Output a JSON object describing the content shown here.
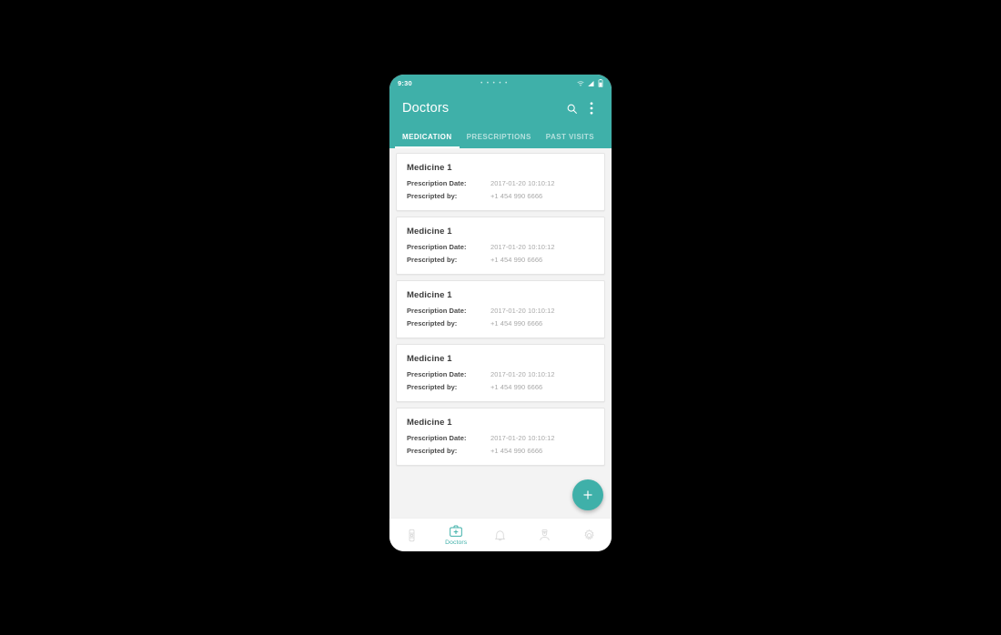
{
  "colors": {
    "accent": "#3fb0a9",
    "appbar_bg": "#3fb0a9",
    "content_bg": "#f3f3f3",
    "card_bg": "#ffffff",
    "title_text": "#3c3c3c",
    "label_text": "#4a4a4a",
    "value_text": "#a8a8a8",
    "tab_inactive": "rgba(255,255,255,0.62)",
    "fab_bg": "#3fb0a9"
  },
  "statusbar": {
    "time": "9:30",
    "center_dots": "• • • • •",
    "icons": [
      "wifi-icon",
      "signal-icon",
      "battery-icon"
    ]
  },
  "appbar": {
    "title": "Doctors",
    "actions": [
      {
        "name": "search-icon",
        "label": "Search"
      },
      {
        "name": "overflow-menu-icon",
        "label": "More options"
      }
    ]
  },
  "tabs": [
    {
      "label": "MEDICATION",
      "active": true
    },
    {
      "label": "PRESCRIPTIONS",
      "active": false
    },
    {
      "label": "PAST VISITS",
      "active": false
    }
  ],
  "list": {
    "labels": {
      "prescription_date": "Prescription Date:",
      "prescripted_by": "Prescripted by:"
    },
    "items": [
      {
        "title": "Medicine 1",
        "prescription_date": "2017-01-20 10:10:12",
        "prescripted_by": "+1 454 990 6666"
      },
      {
        "title": "Medicine 1",
        "prescription_date": "2017-01-20 10:10:12",
        "prescripted_by": "+1 454 990 6666"
      },
      {
        "title": "Medicine 1",
        "prescription_date": "2017-01-20 10:10:12",
        "prescripted_by": "+1 454 990 6666"
      },
      {
        "title": "Medicine 1",
        "prescription_date": "2017-01-20 10:10:12",
        "prescripted_by": "+1 454 990 6666"
      },
      {
        "title": "Medicine 1",
        "prescription_date": "2017-01-20 10:10:12",
        "prescripted_by": "+1 454 990 6666"
      }
    ]
  },
  "fab": {
    "icon": "plus-icon",
    "label": "+"
  },
  "bottomnav": {
    "items": [
      {
        "icon": "pill-pack-icon",
        "label": "",
        "active": false
      },
      {
        "icon": "medical-bag-icon",
        "label": "Doctors",
        "active": true
      },
      {
        "icon": "bell-icon",
        "label": "",
        "active": false
      },
      {
        "icon": "doctor-person-icon",
        "label": "",
        "active": false
      },
      {
        "icon": "gear-icon",
        "label": "",
        "active": false
      }
    ]
  }
}
